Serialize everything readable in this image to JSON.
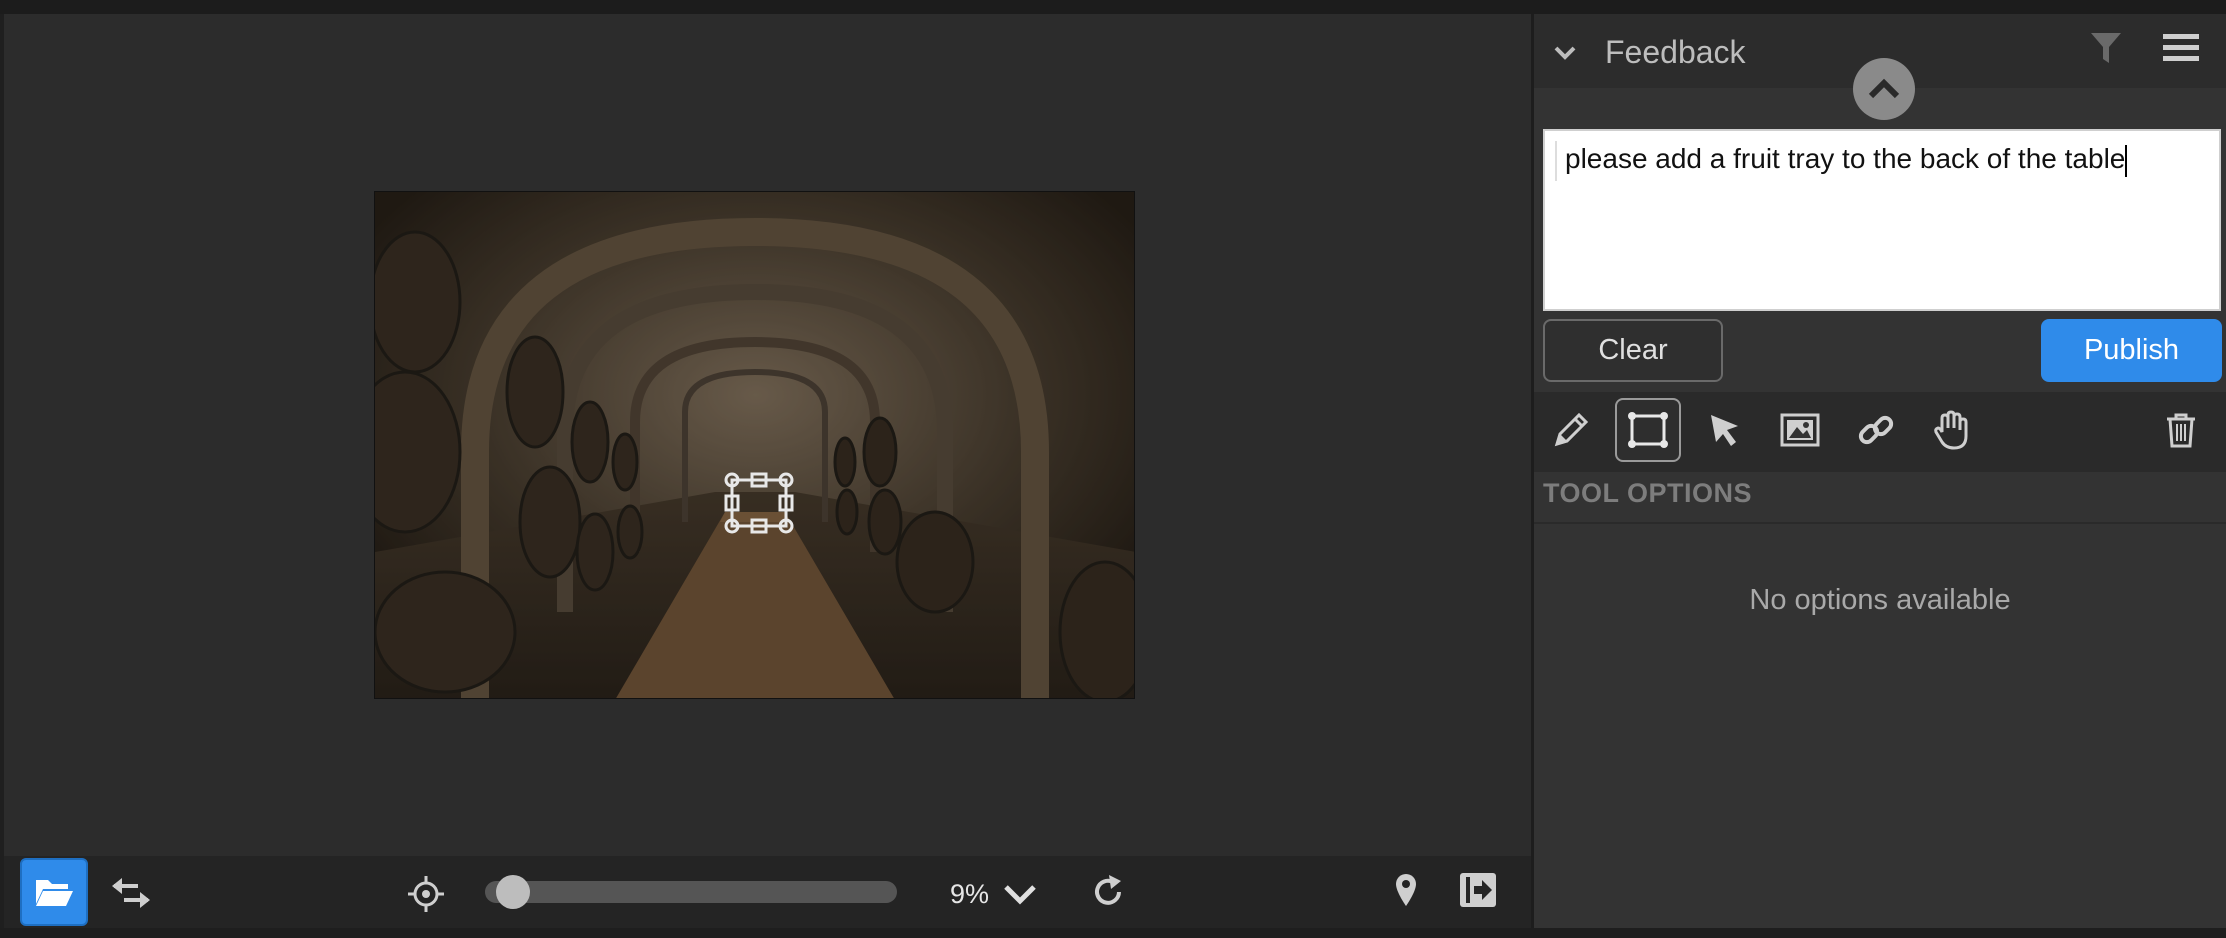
{
  "viewer": {
    "zoom_label": "9%",
    "zoom_fraction": 0.03
  },
  "panel": {
    "title": "Feedback",
    "comment_text": "please add a fruit tray to the back of the table",
    "clear_label": "Clear",
    "publish_label": "Publish",
    "tool_options_label": "TOOL OPTIONS",
    "no_options_text": "No options available",
    "active_tool": "rectangle-tool"
  },
  "colors": {
    "accent": "#2f8bea",
    "panel_bg": "#333333",
    "viewer_bg": "#2c2c2c"
  }
}
